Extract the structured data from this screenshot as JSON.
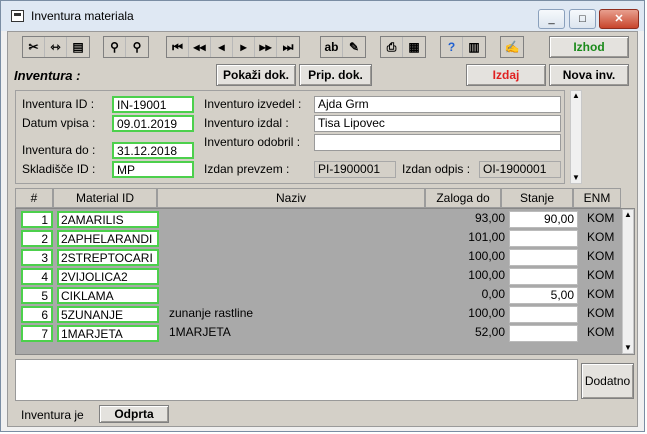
{
  "window": {
    "title": "Inventura materiala"
  },
  "toolbar": {
    "exit_label": "Izhod",
    "show_doc_label": "Pokaži dok.",
    "prep_doc_label": "Prip. dok.",
    "issue_label": "Izdaj",
    "new_inv_label": "Nova inv."
  },
  "header": {
    "title": "Inventura :"
  },
  "form": {
    "inventura_id_label": "Inventura ID :",
    "inventura_id": "IN-19001",
    "datum_vpisa_label": "Datum vpisa :",
    "datum_vpisa": "09.01.2019",
    "inventura_do_label": "Inventura do :",
    "inventura_do": "31.12.2018",
    "skladisce_label": "Skladišče ID :",
    "skladisce": "MP",
    "izvedel_label": "Inventuro izvedel :",
    "izvedel": "Ajda Grm",
    "izdal_label": "Inventuro izdal :",
    "izdal": "Tisa Lipovec",
    "odobril_label": "Inventuro odobril :",
    "odobril": "",
    "prevzem_label": "Izdan prevzem :",
    "prevzem": "PI-1900001",
    "odpis_label": "Izdan odpis :",
    "odpis": "OI-1900001"
  },
  "table": {
    "columns": [
      "#",
      "Material ID",
      "Naziv",
      "Zaloga do",
      "Stanje",
      "ENM"
    ],
    "rows": [
      {
        "num": "1",
        "material": "2AMARILIS",
        "naziv": "",
        "zaloga": "93,00",
        "stanje": "90,00",
        "enm": "KOM"
      },
      {
        "num": "2",
        "material": "2APHELARANDI",
        "naziv": "",
        "zaloga": "101,00",
        "stanje": "",
        "enm": "KOM"
      },
      {
        "num": "3",
        "material": "2STREPTOCARI",
        "naziv": "",
        "zaloga": "100,00",
        "stanje": "",
        "enm": "KOM"
      },
      {
        "num": "4",
        "material": "2VIJOLICA2",
        "naziv": "",
        "zaloga": "100,00",
        "stanje": "",
        "enm": "KOM"
      },
      {
        "num": "5",
        "material": "CIKLAMA",
        "naziv": "",
        "zaloga": "0,00",
        "stanje": "5,00",
        "enm": "KOM"
      },
      {
        "num": "6",
        "material": "5ZUNANJE",
        "naziv": "zunanje rastline",
        "zaloga": "100,00",
        "stanje": "",
        "enm": "KOM"
      },
      {
        "num": "7",
        "material": "1MARJETA",
        "naziv": "1MARJETA",
        "zaloga": "52,00",
        "stanje": "",
        "enm": "KOM"
      }
    ]
  },
  "footer": {
    "note": "",
    "add_label": "Dodatno",
    "status_label": "Inventura je",
    "status_value": "Odprta"
  },
  "icons": [
    "cut-icon",
    "split-icon",
    "paste-icon",
    "find-icon",
    "find-next-icon",
    "first-icon",
    "prev-page-icon",
    "prev-icon",
    "next-icon",
    "next-page-icon",
    "last-icon",
    "text-icon",
    "edit-icon",
    "print-icon",
    "document-icon",
    "help-icon",
    "chart-icon",
    "sign-icon"
  ]
}
